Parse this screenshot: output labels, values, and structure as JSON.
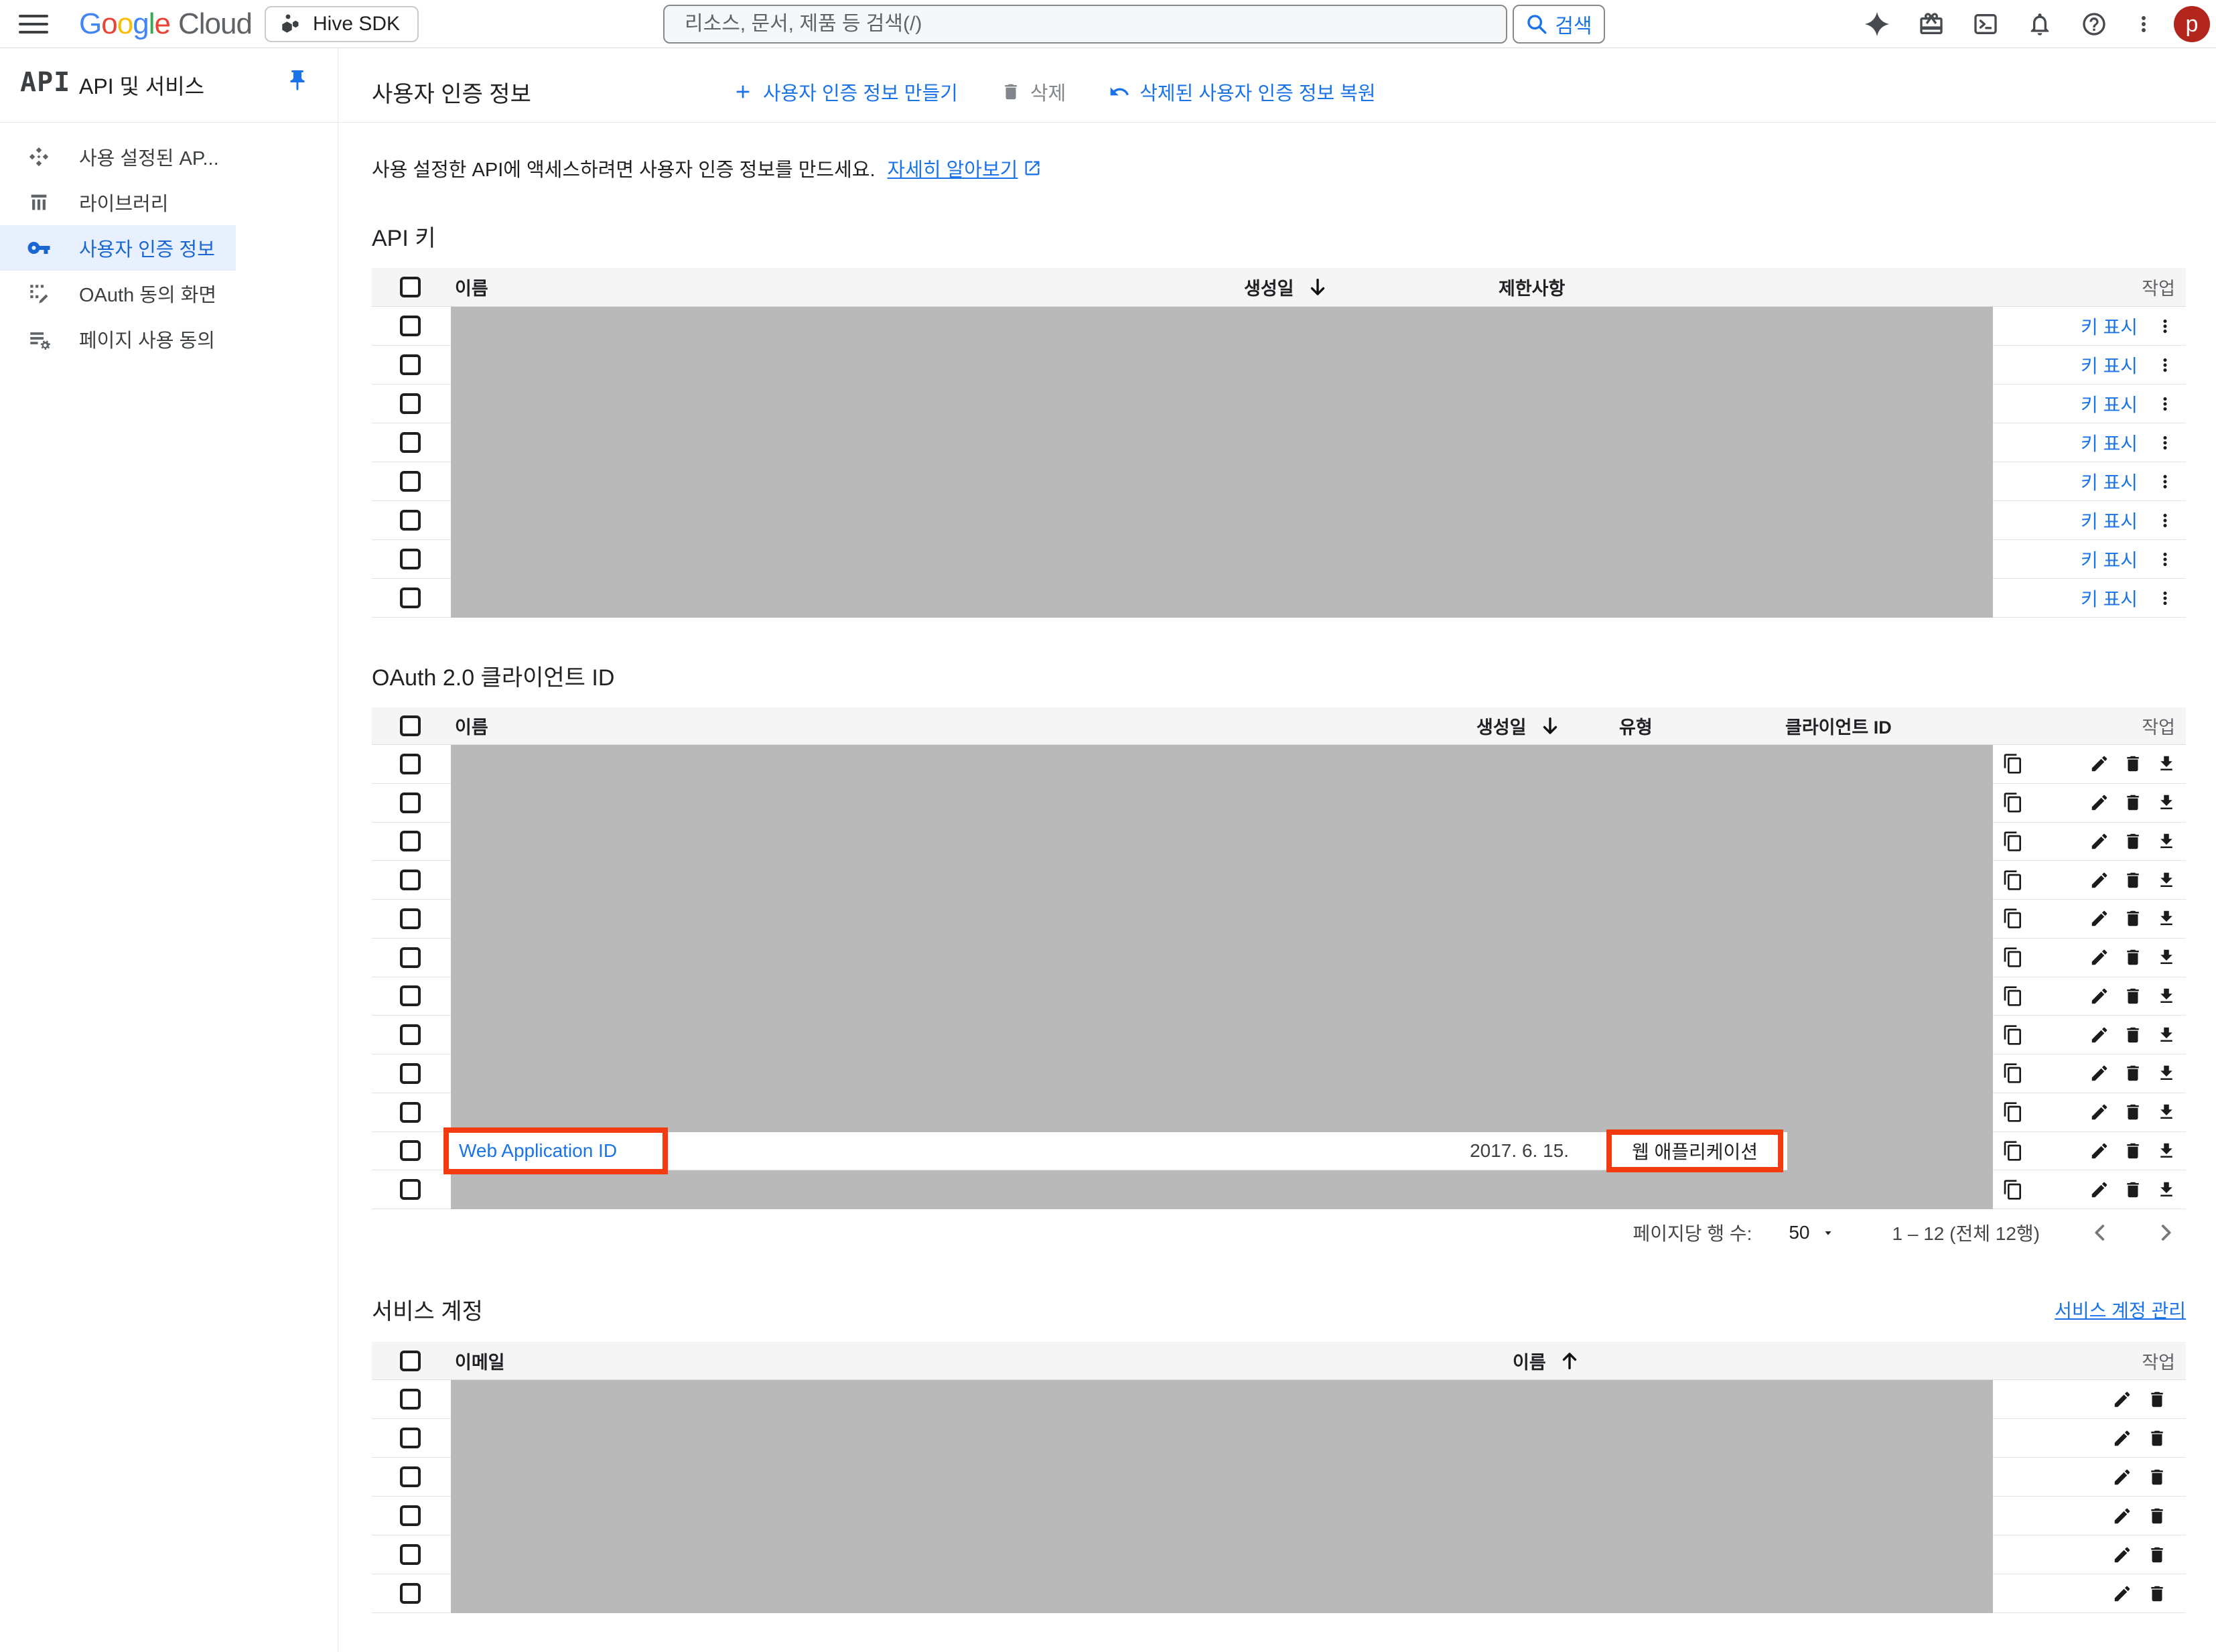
{
  "topbar": {
    "logo_google": "Google",
    "logo_cloud": "Cloud",
    "project_name": "Hive SDK",
    "search_placeholder": "리소스, 문서, 제품 등 검색(/)",
    "search_button_label": "검색",
    "avatar_letter": "p"
  },
  "sidebar": {
    "product_glyph": "API",
    "title": "API 및 서비스",
    "items": [
      {
        "label": "사용 설정된 AP..."
      },
      {
        "label": "라이브러리"
      },
      {
        "label": "사용자 인증 정보"
      },
      {
        "label": "OAuth 동의 화면"
      },
      {
        "label": "페이지 사용 동의"
      }
    ]
  },
  "page_header": {
    "title": "사용자 인증 정보",
    "create_button": "사용자 인증 정보 만들기",
    "delete_button": "삭제",
    "restore_button": "삭제된 사용자 인증 정보 복원"
  },
  "intro": {
    "text": "사용 설정한 API에 액세스하려면 사용자 인증 정보를 만드세요.",
    "link_label": "자세히 알아보기"
  },
  "api_keys": {
    "section_title": "API 키",
    "columns": {
      "name": "이름",
      "created": "생성일",
      "restrictions": "제한사항",
      "actions": "작업"
    },
    "show_key_label": "키 표시",
    "redacted_row_count": 8
  },
  "oauth_clients": {
    "section_title": "OAuth 2.0 클라이언트 ID",
    "columns": {
      "name": "이름",
      "created": "생성일",
      "type": "유형",
      "client_id": "클라이언트 ID",
      "actions": "작업"
    },
    "redacted_rows_before": 10,
    "redacted_rows_after": 1,
    "highlighted_row": {
      "name": "Web Application ID",
      "created": "2017. 6. 15.",
      "type": "웹 애플리케이션"
    }
  },
  "pagination": {
    "rows_per_page_label": "페이지당 행 수:",
    "rows_per_page_value": "50",
    "range_label": "1 – 12 (전체 12행)"
  },
  "service_accounts": {
    "section_title": "서비스 계정",
    "manage_link": "서비스 계정 관리",
    "columns": {
      "email": "이메일",
      "name": "이름",
      "actions": "작업"
    },
    "redacted_row_count": 6
  },
  "colors": {
    "accent_blue": "#1a73e8",
    "annotation_red": "#f23b0f",
    "redaction_gray": "#b9b9b9",
    "avatar_red": "#b3261e"
  }
}
